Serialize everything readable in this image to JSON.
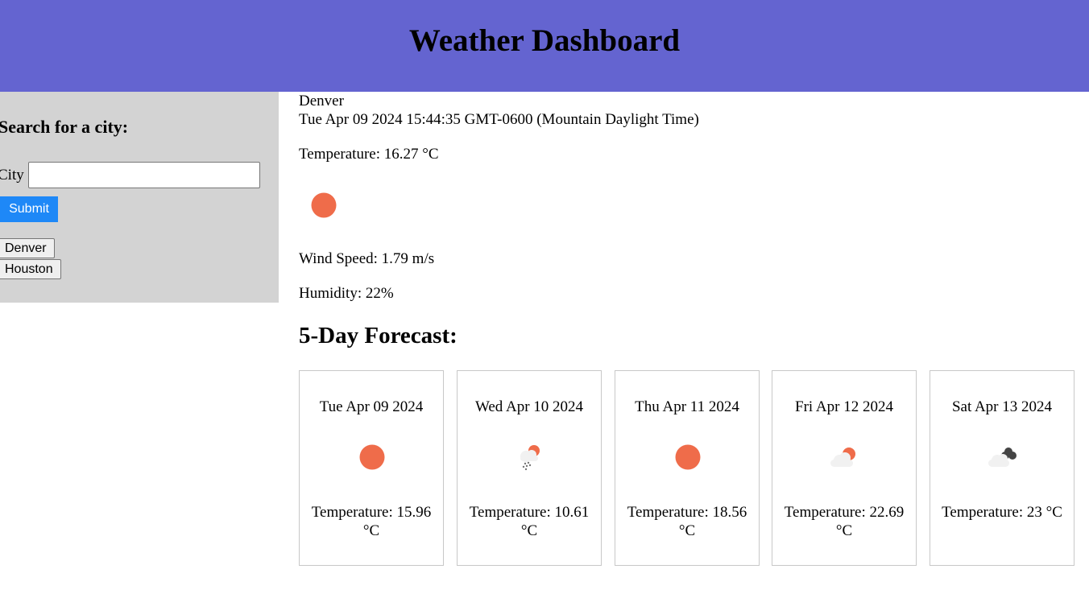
{
  "header": {
    "title": "Weather Dashboard"
  },
  "sidebar": {
    "heading": "Search for a city:",
    "city_label": "City",
    "city_value": "",
    "submit_label": "Submit",
    "history": [
      "Denver",
      "Houston"
    ]
  },
  "current": {
    "city": "Denver",
    "date": "Tue Apr 09 2024 15:44:35 GMT-0600 (Mountain Daylight Time)",
    "temperature": "Temperature: 16.27 °C",
    "icon": "sun-icon",
    "wind": "Wind Speed: 1.79 m/s",
    "humidity": "Humidity: 22%"
  },
  "forecast": {
    "title": "5-Day Forecast:",
    "days": [
      {
        "date": "Tue Apr 09 2024",
        "icon": "sun-icon",
        "temperature": "Temperature: 15.96 °C"
      },
      {
        "date": "Wed Apr 10 2024",
        "icon": "rain-icon",
        "temperature": "Temperature: 10.61 °C"
      },
      {
        "date": "Thu Apr 11 2024",
        "icon": "sun-icon",
        "temperature": "Temperature: 18.56 °C"
      },
      {
        "date": "Fri Apr 12 2024",
        "icon": "partly-cloudy-icon",
        "temperature": "Temperature: 22.69 °C"
      },
      {
        "date": "Sat Apr 13 2024",
        "icon": "broken-clouds-icon",
        "temperature": "Temperature: 23 °C"
      }
    ]
  },
  "colors": {
    "header_bg": "#6464d0",
    "sidebar_bg": "#d3d3d3",
    "submit_bg": "#1e88f7",
    "sun": "#ef6c4a"
  }
}
